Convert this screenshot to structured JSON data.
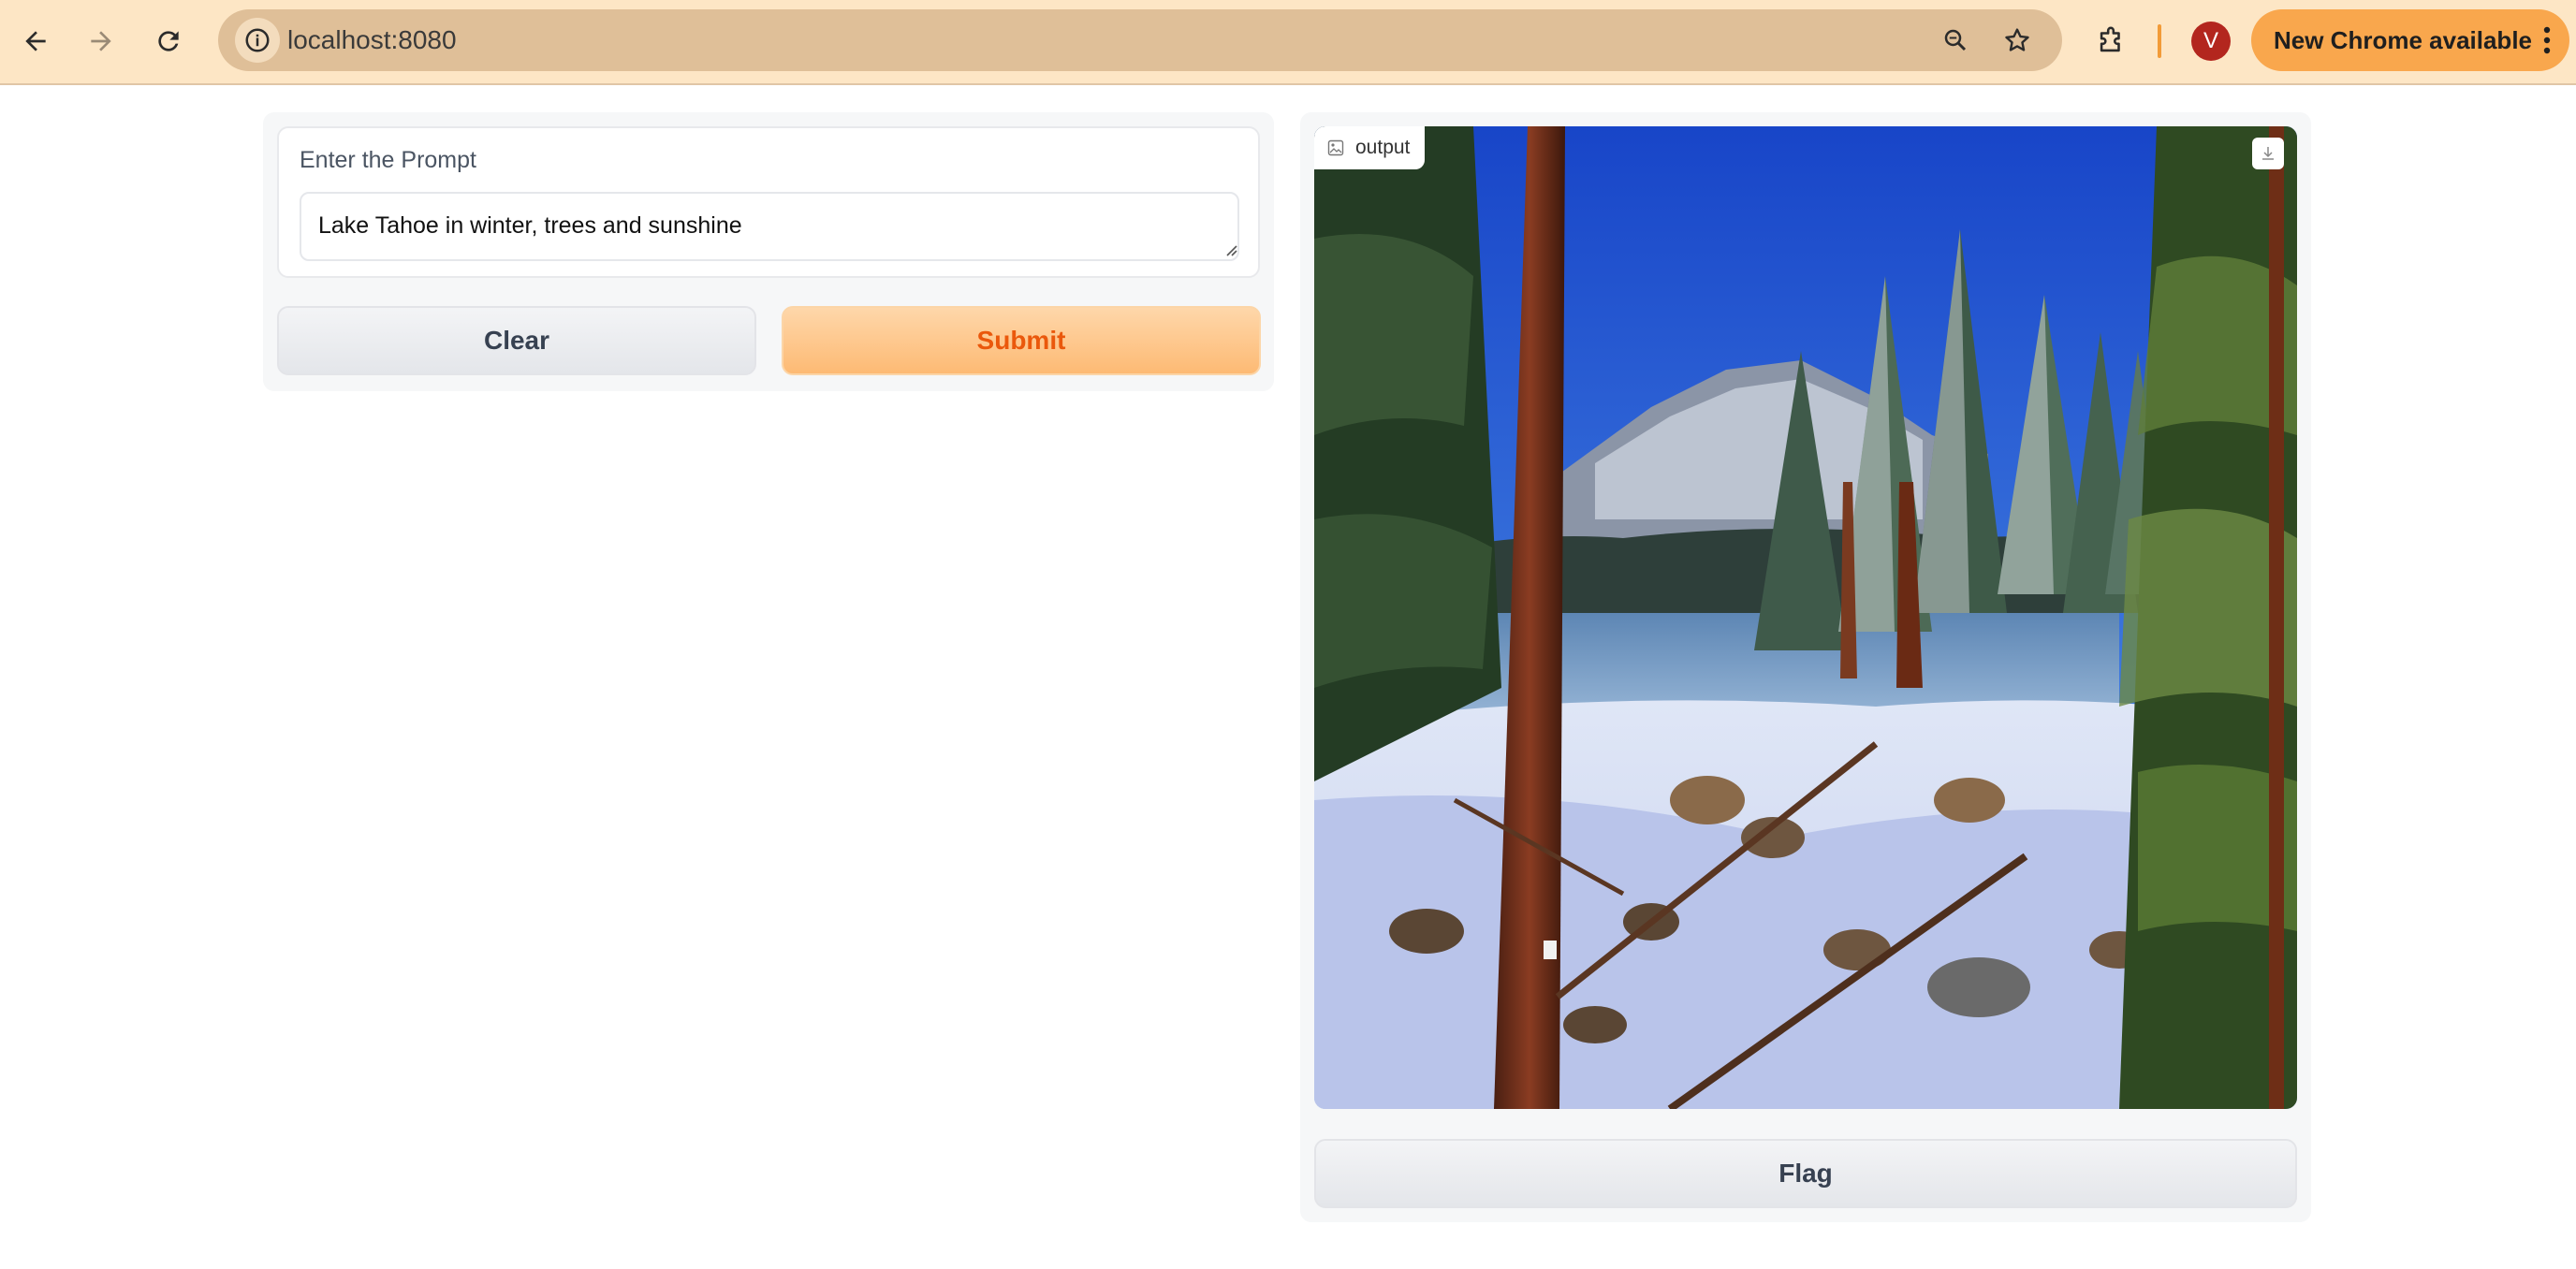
{
  "browser": {
    "url": "localhost:8080",
    "update_label": "New Chrome available",
    "avatar_letter": "V",
    "icons": [
      "back-icon",
      "forward-icon",
      "reload-icon",
      "site-info-icon",
      "zoom-icon",
      "bookmark-star-icon",
      "extensions-icon",
      "more-vert-icon"
    ],
    "colors": {
      "toolbar": "#fde6c5",
      "omnibox": "#dfbf98",
      "update_pill": "#f9a74d",
      "avatar": "#b3261e"
    }
  },
  "form": {
    "prompt_label": "Enter the Prompt",
    "prompt_value": "Lake Tahoe in winter, trees and sunshine",
    "clear_label": "Clear",
    "submit_label": "Submit"
  },
  "output": {
    "label": "output",
    "image_description_icon": "image-icon",
    "download_icon": "download-icon",
    "flag_label": "Flag"
  }
}
